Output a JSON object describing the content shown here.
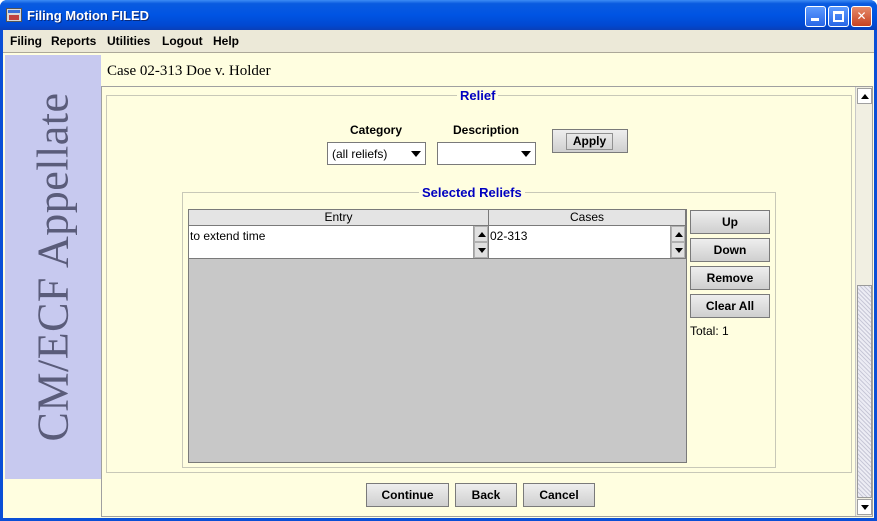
{
  "window": {
    "title": "Filing Motion FILED",
    "controls": {
      "minimize": "minimize",
      "maximize": "maximize",
      "close": "✕"
    }
  },
  "menu": [
    "Filing",
    "Reports",
    "Utilities",
    "Logout",
    "Help"
  ],
  "sidebar": {
    "brand": "CM/ECF Appellate"
  },
  "case": {
    "title": "Case 02-313 Doe v. Holder"
  },
  "relief": {
    "heading": "Relief",
    "category_label": "Category",
    "category_value": "(all reliefs)",
    "description_label": "Description",
    "description_value": "",
    "apply_label": "Apply"
  },
  "selected": {
    "heading": "Selected Reliefs",
    "columns": [
      "Entry",
      "Cases"
    ],
    "rows": [
      {
        "entry": "to extend time",
        "cases": "02-313"
      }
    ],
    "buttons": {
      "up": "Up",
      "down": "Down",
      "remove": "Remove",
      "clear_all": "Clear All"
    },
    "total": "Total: 1"
  },
  "footer": {
    "continue": "Continue",
    "back": "Back",
    "cancel": "Cancel"
  },
  "colors": {
    "title_bar": "#0054e3",
    "panel_bg": "#fffee0",
    "sidebar_bg": "#c7c9ef",
    "heading_text": "#0000c0"
  }
}
